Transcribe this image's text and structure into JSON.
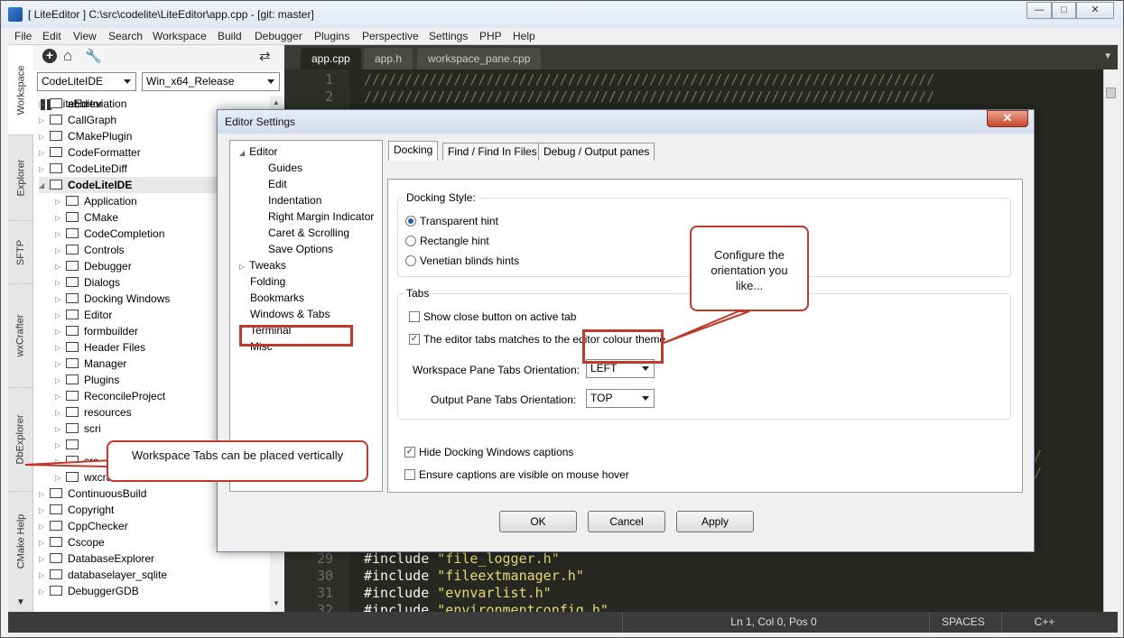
{
  "window": {
    "title": "[ LiteEditor ] C:\\src\\codelite\\LiteEditor\\app.cpp - [git: master]",
    "min_label": "—",
    "max_label": "□",
    "close_label": "✕"
  },
  "menu": [
    "File",
    "Edit",
    "View",
    "Search",
    "Workspace",
    "Build",
    "Debugger",
    "Plugins",
    "Perspective",
    "Settings",
    "PHP",
    "Help"
  ],
  "vertical_tabs": [
    "Workspace",
    "Explorer",
    "SFTP",
    "wxCrafter",
    "DbExplorer",
    "CMake Help"
  ],
  "workspace": {
    "project_combo": "CodeLiteIDE",
    "config_combo": "Win_x64_Release",
    "tree_root": "LiteEditor",
    "tree": [
      {
        "label": "abbreviation",
        "level": 1,
        "bold": false
      },
      {
        "label": "CallGraph",
        "level": 1,
        "bold": false
      },
      {
        "label": "CMakePlugin",
        "level": 1,
        "bold": false
      },
      {
        "label": "CodeFormatter",
        "level": 1,
        "bold": false
      },
      {
        "label": "CodeLiteDiff",
        "level": 1,
        "bold": false
      },
      {
        "label": "CodeLiteIDE",
        "level": 1,
        "bold": true
      },
      {
        "label": "Application",
        "level": 2,
        "bold": false
      },
      {
        "label": "CMake",
        "level": 2,
        "bold": false
      },
      {
        "label": "CodeCompletion",
        "level": 2,
        "bold": false
      },
      {
        "label": "Controls",
        "level": 2,
        "bold": false
      },
      {
        "label": "Debugger",
        "level": 2,
        "bold": false
      },
      {
        "label": "Dialogs",
        "level": 2,
        "bold": false
      },
      {
        "label": "Docking Windows",
        "level": 2,
        "bold": false
      },
      {
        "label": "Editor",
        "level": 2,
        "bold": false
      },
      {
        "label": "formbuilder",
        "level": 2,
        "bold": false
      },
      {
        "label": "Header Files",
        "level": 2,
        "bold": false
      },
      {
        "label": "Manager",
        "level": 2,
        "bold": false
      },
      {
        "label": "Plugins",
        "level": 2,
        "bold": false
      },
      {
        "label": "ReconcileProject",
        "level": 2,
        "bold": false
      },
      {
        "label": "resources",
        "level": 2,
        "bold": false
      },
      {
        "label": "scri",
        "level": 2,
        "bold": false
      },
      {
        "label": "",
        "level": 2,
        "bold": false
      },
      {
        "label": "src",
        "level": 2,
        "bold": false
      },
      {
        "label": "wxcrafter",
        "level": 2,
        "bold": false
      },
      {
        "label": "ContinuousBuild",
        "level": 1,
        "bold": false
      },
      {
        "label": "Copyright",
        "level": 1,
        "bold": false
      },
      {
        "label": "CppChecker",
        "level": 1,
        "bold": false
      },
      {
        "label": "Cscope",
        "level": 1,
        "bold": false
      },
      {
        "label": "DatabaseExplorer",
        "level": 1,
        "bold": false
      },
      {
        "label": "databaselayer_sqlite",
        "level": 1,
        "bold": false
      },
      {
        "label": "DebuggerGDB",
        "level": 1,
        "bold": false
      }
    ]
  },
  "editor": {
    "tabs": [
      "app.cpp",
      "app.h",
      "workspace_pane.cpp"
    ],
    "lines_top": [
      {
        "num": "1",
        "text": "//////////////////////////////////////////////////////////////////////"
      },
      {
        "num": "2",
        "text": "//////////////////////////////////////////////////////////////////////"
      }
    ],
    "lines_bottom": [
      {
        "num": "29",
        "kw": "#include",
        "str": "\"file_logger.h\""
      },
      {
        "num": "30",
        "kw": "#include",
        "str": "\"fileextmanager.h\""
      },
      {
        "num": "31",
        "kw": "#include",
        "str": "\"evnvarlist.h\""
      },
      {
        "num": "32",
        "kw": "#include",
        "str": "\"environmentconfig.h\""
      }
    ],
    "right_slashes": [
      "///",
      "///"
    ]
  },
  "status": {
    "position": "Ln 1, Col 0, Pos 0",
    "indent": "SPACES",
    "lang": "C++"
  },
  "dialog": {
    "title": "Editor Settings",
    "close_label": "✕",
    "tree": [
      {
        "label": "Editor",
        "level": 0,
        "exp": "◢"
      },
      {
        "label": "Guides",
        "level": 1
      },
      {
        "label": "Edit",
        "level": 1
      },
      {
        "label": "Indentation",
        "level": 1
      },
      {
        "label": "Right Margin Indicator",
        "level": 1
      },
      {
        "label": "Caret & Scrolling",
        "level": 1
      },
      {
        "label": "Save Options",
        "level": 1
      },
      {
        "label": "Tweaks",
        "level": 0,
        "exp": "▷"
      },
      {
        "label": "Folding",
        "level": 0
      },
      {
        "label": "Bookmarks",
        "level": 0
      },
      {
        "label": "Windows & Tabs",
        "level": 0
      },
      {
        "label": "Terminal",
        "level": 0
      },
      {
        "label": "Misc",
        "level": 0
      }
    ],
    "page_tabs": [
      "Docking",
      "Find / Find In Files",
      "Debug / Output panes"
    ],
    "docking_style_label": "Docking Style:",
    "docking_options": [
      "Transparent hint",
      "Rectangle hint",
      "Venetian blinds hints"
    ],
    "tabs_label": "Tabs",
    "show_close_label": "Show close button on active tab",
    "match_theme_label": "The editor tabs matches to the editor colour theme",
    "workspace_orient_label": "Workspace Pane Tabs Orientation:",
    "workspace_orient_value": "LEFT",
    "output_orient_label": "Output Pane Tabs Orientation:",
    "output_orient_value": "TOP",
    "hide_captions_label": "Hide Docking Windows captions",
    "ensure_captions_label": "Ensure captions are visible on mouse hover",
    "ok_label": "OK",
    "cancel_label": "Cancel",
    "apply_label": "Apply",
    "check_mark": "✓"
  },
  "callouts": {
    "orientation": "Configure the orientation you like...",
    "vertical": "Workspace Tabs can be placed vertically"
  },
  "colors": {
    "accent_red": "#c0392b",
    "editor_bg": "#272822",
    "string": "#e6db74"
  }
}
